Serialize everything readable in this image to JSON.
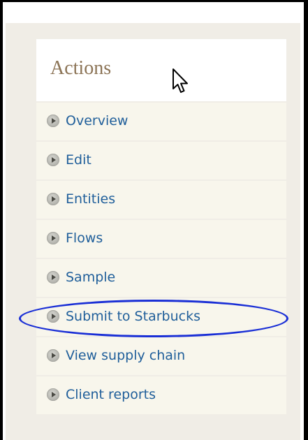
{
  "block": {
    "title": "Actions"
  },
  "menu": {
    "items": [
      {
        "label": "Overview"
      },
      {
        "label": "Edit"
      },
      {
        "label": "Entities"
      },
      {
        "label": "Flows"
      },
      {
        "label": "Sample"
      },
      {
        "label": "Submit to Starbucks"
      },
      {
        "label": "View supply chain"
      },
      {
        "label": "Client reports"
      }
    ]
  },
  "icons": {
    "bullet": "play-circle-icon",
    "cursor": "mouse-pointer-icon"
  },
  "colors": {
    "link": "#1f5e9a",
    "title": "#8b7355",
    "panel_bg": "#f0ede6",
    "item_bg": "#f8f6ec",
    "highlight": "#1a2fd6"
  }
}
